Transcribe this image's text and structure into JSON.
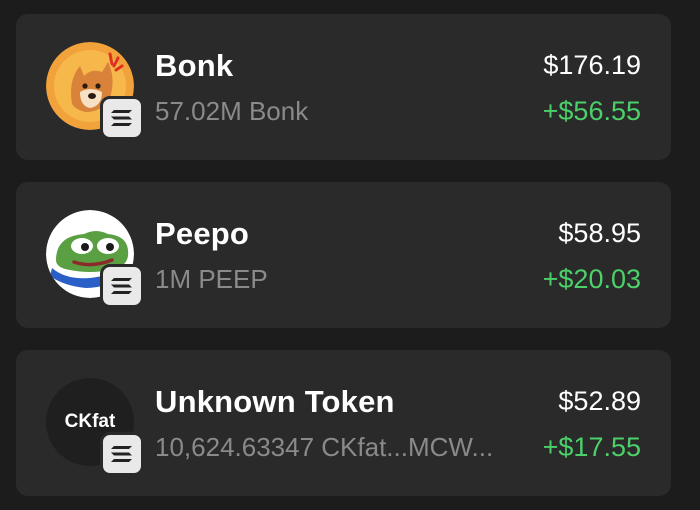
{
  "tokens": [
    {
      "name": "Bonk",
      "amount": "57.02M Bonk",
      "value": "$176.19",
      "change": "+$56.55",
      "avatar_icon": "bonk-dog-icon",
      "chain_icon": "solana-icon"
    },
    {
      "name": "Peepo",
      "amount": "1M PEEP",
      "value": "$58.95",
      "change": "+$20.03",
      "avatar_icon": "peepo-frog-icon",
      "chain_icon": "solana-icon"
    },
    {
      "name": "Unknown Token",
      "amount": "10,624.63347 CKfat...MCW...",
      "value": "$52.89",
      "change": "+$17.55",
      "avatar_text": "CKfat",
      "chain_icon": "solana-icon"
    }
  ],
  "colors": {
    "background": "#1c1c1c",
    "card": "#2a2a2a",
    "positive": "#4cd06a",
    "muted": "#8a8a8a"
  }
}
